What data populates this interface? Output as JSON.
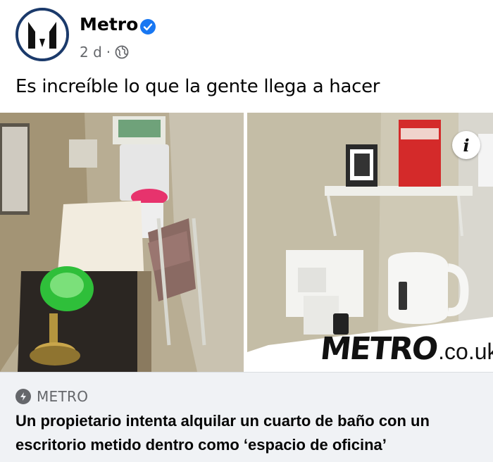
{
  "post": {
    "author_name": "Metro",
    "time_ago": "2 d",
    "separator": "·",
    "text": "Es increíble lo que la gente llega a hacer"
  },
  "photos": {
    "info_label": "i",
    "watermark_main": "METRO",
    "watermark_suffix": ".co.uk"
  },
  "link_card": {
    "source": "METRO",
    "title": "Un propietario intenta alquilar un cuarto de baño con un escritorio metido dentro como ‘espacio de oficina’"
  },
  "colors": {
    "verified_blue": "#1877f2",
    "meta_gray": "#65676b",
    "card_background": "#f0f2f5",
    "lamp_green": "#2fbf3a"
  },
  "icons": [
    "metro-logo-icon",
    "verified-badge-icon",
    "globe-icon",
    "info-icon",
    "bolt-icon"
  ]
}
